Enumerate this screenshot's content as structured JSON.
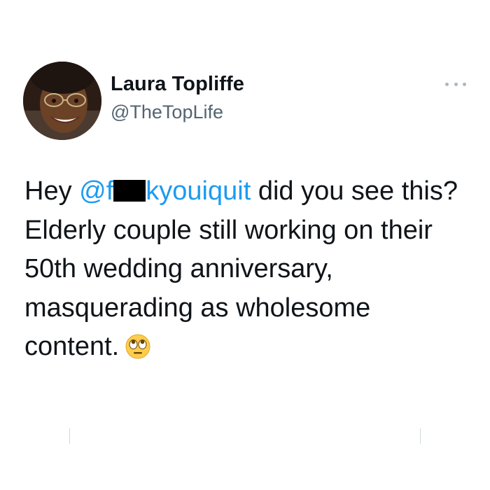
{
  "tweet": {
    "author_name": "Laura Topliffe",
    "author_handle": "@TheTopLife",
    "text_intro": "Hey ",
    "mention_start": "@f",
    "mention_end": "kyouiquit",
    "text_after_mention": " did you see this?",
    "line_2": "Elderly couple still working on their 50th wedding anniversary, masquerading as wholesome content.",
    "emoji": "face-with-rolling-eyes-emoji"
  },
  "colors": {
    "text": "#0f1419",
    "handle": "#536471",
    "mention": "#1d9bf0",
    "more_dots": "#aab8c2"
  },
  "icons": {
    "more": "more-options-icon"
  }
}
